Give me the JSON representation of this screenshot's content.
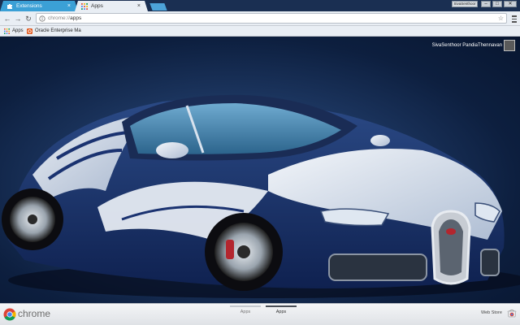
{
  "tabs": [
    {
      "label": "Extensions",
      "icon": "puzzle-icon",
      "active": false
    },
    {
      "label": "Apps",
      "icon": "apps-grid-icon",
      "active": true
    }
  ],
  "window": {
    "user_chip": "SivaSenthoor",
    "minimize": "–",
    "maximize": "□",
    "close": "✕"
  },
  "toolbar": {
    "url_scheme": "chrome://",
    "url_path": "apps",
    "back": "←",
    "forward": "→",
    "reload": "↻",
    "star": "☆"
  },
  "bookmarks": [
    {
      "label": "Apps",
      "icon": "apps-grid-icon"
    },
    {
      "label": "Oracle Enterprise Ma",
      "icon": "oracle-icon"
    }
  ],
  "content": {
    "user_name": "SivaSenthoor PandiaThennavan"
  },
  "launcher": {
    "brand": "chrome",
    "pages": [
      {
        "label": "Apps",
        "active": false
      },
      {
        "label": "Apps",
        "active": true
      }
    ],
    "web_store": "Web Store"
  },
  "colors": {
    "tab_active_blue": "#3ba0d6",
    "titlebar": "#1a2f52",
    "toolbar": "#e9eef4",
    "wallpaper_dark": "#0d1f3f"
  }
}
